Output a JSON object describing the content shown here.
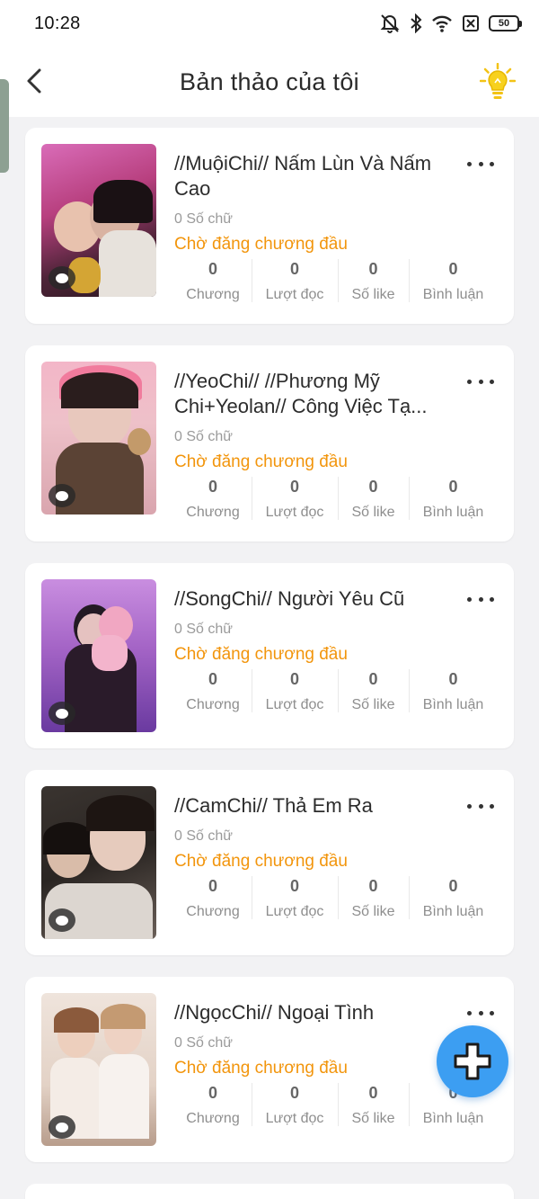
{
  "status_bar": {
    "time": "10:28",
    "battery": "50"
  },
  "header": {
    "title": "Bản thảo của tôi"
  },
  "stat_labels": {
    "chapters": "Chương",
    "reads": "Lượt đọc",
    "likes": "Số like",
    "comments": "Bình luận"
  },
  "stories": [
    {
      "title": "//MuộiChi// Nấm Lùn Và Nấm Cao",
      "word_count": "0 Số chữ",
      "status": "Chờ đăng chương đầu",
      "chapters": "0",
      "reads": "0",
      "likes": "0",
      "comments": "0"
    },
    {
      "title": "//YeoChi// //Phương Mỹ Chi+Yeolan// Công Việc Tạ...",
      "word_count": "0 Số chữ",
      "status": "Chờ đăng chương đầu",
      "chapters": "0",
      "reads": "0",
      "likes": "0",
      "comments": "0"
    },
    {
      "title": "//SongChi// Người Yêu Cũ",
      "word_count": "0 Số chữ",
      "status": "Chờ đăng chương đầu",
      "chapters": "0",
      "reads": "0",
      "likes": "0",
      "comments": "0"
    },
    {
      "title": "//CamChi// Thả Em Ra",
      "word_count": "0 Số chữ",
      "status": "Chờ đăng chương đầu",
      "chapters": "0",
      "reads": "0",
      "likes": "0",
      "comments": "0"
    },
    {
      "title": "//NgọcChi// Ngoại Tình",
      "word_count": "0 Số chữ",
      "status": "Chờ đăng chương đầu",
      "chapters": "0",
      "reads": "0",
      "likes": "0",
      "comments": "0"
    }
  ],
  "colors": {
    "accent_orange": "#f2950c",
    "fab_blue": "#3c9ef2",
    "background": "#f2f2f4"
  },
  "icons": {
    "back": "chevron-left-icon",
    "tips": "lightbulb-icon",
    "more": "more-horizontal-icon",
    "add": "plus-icon",
    "comment": "comment-bubble-icon"
  }
}
